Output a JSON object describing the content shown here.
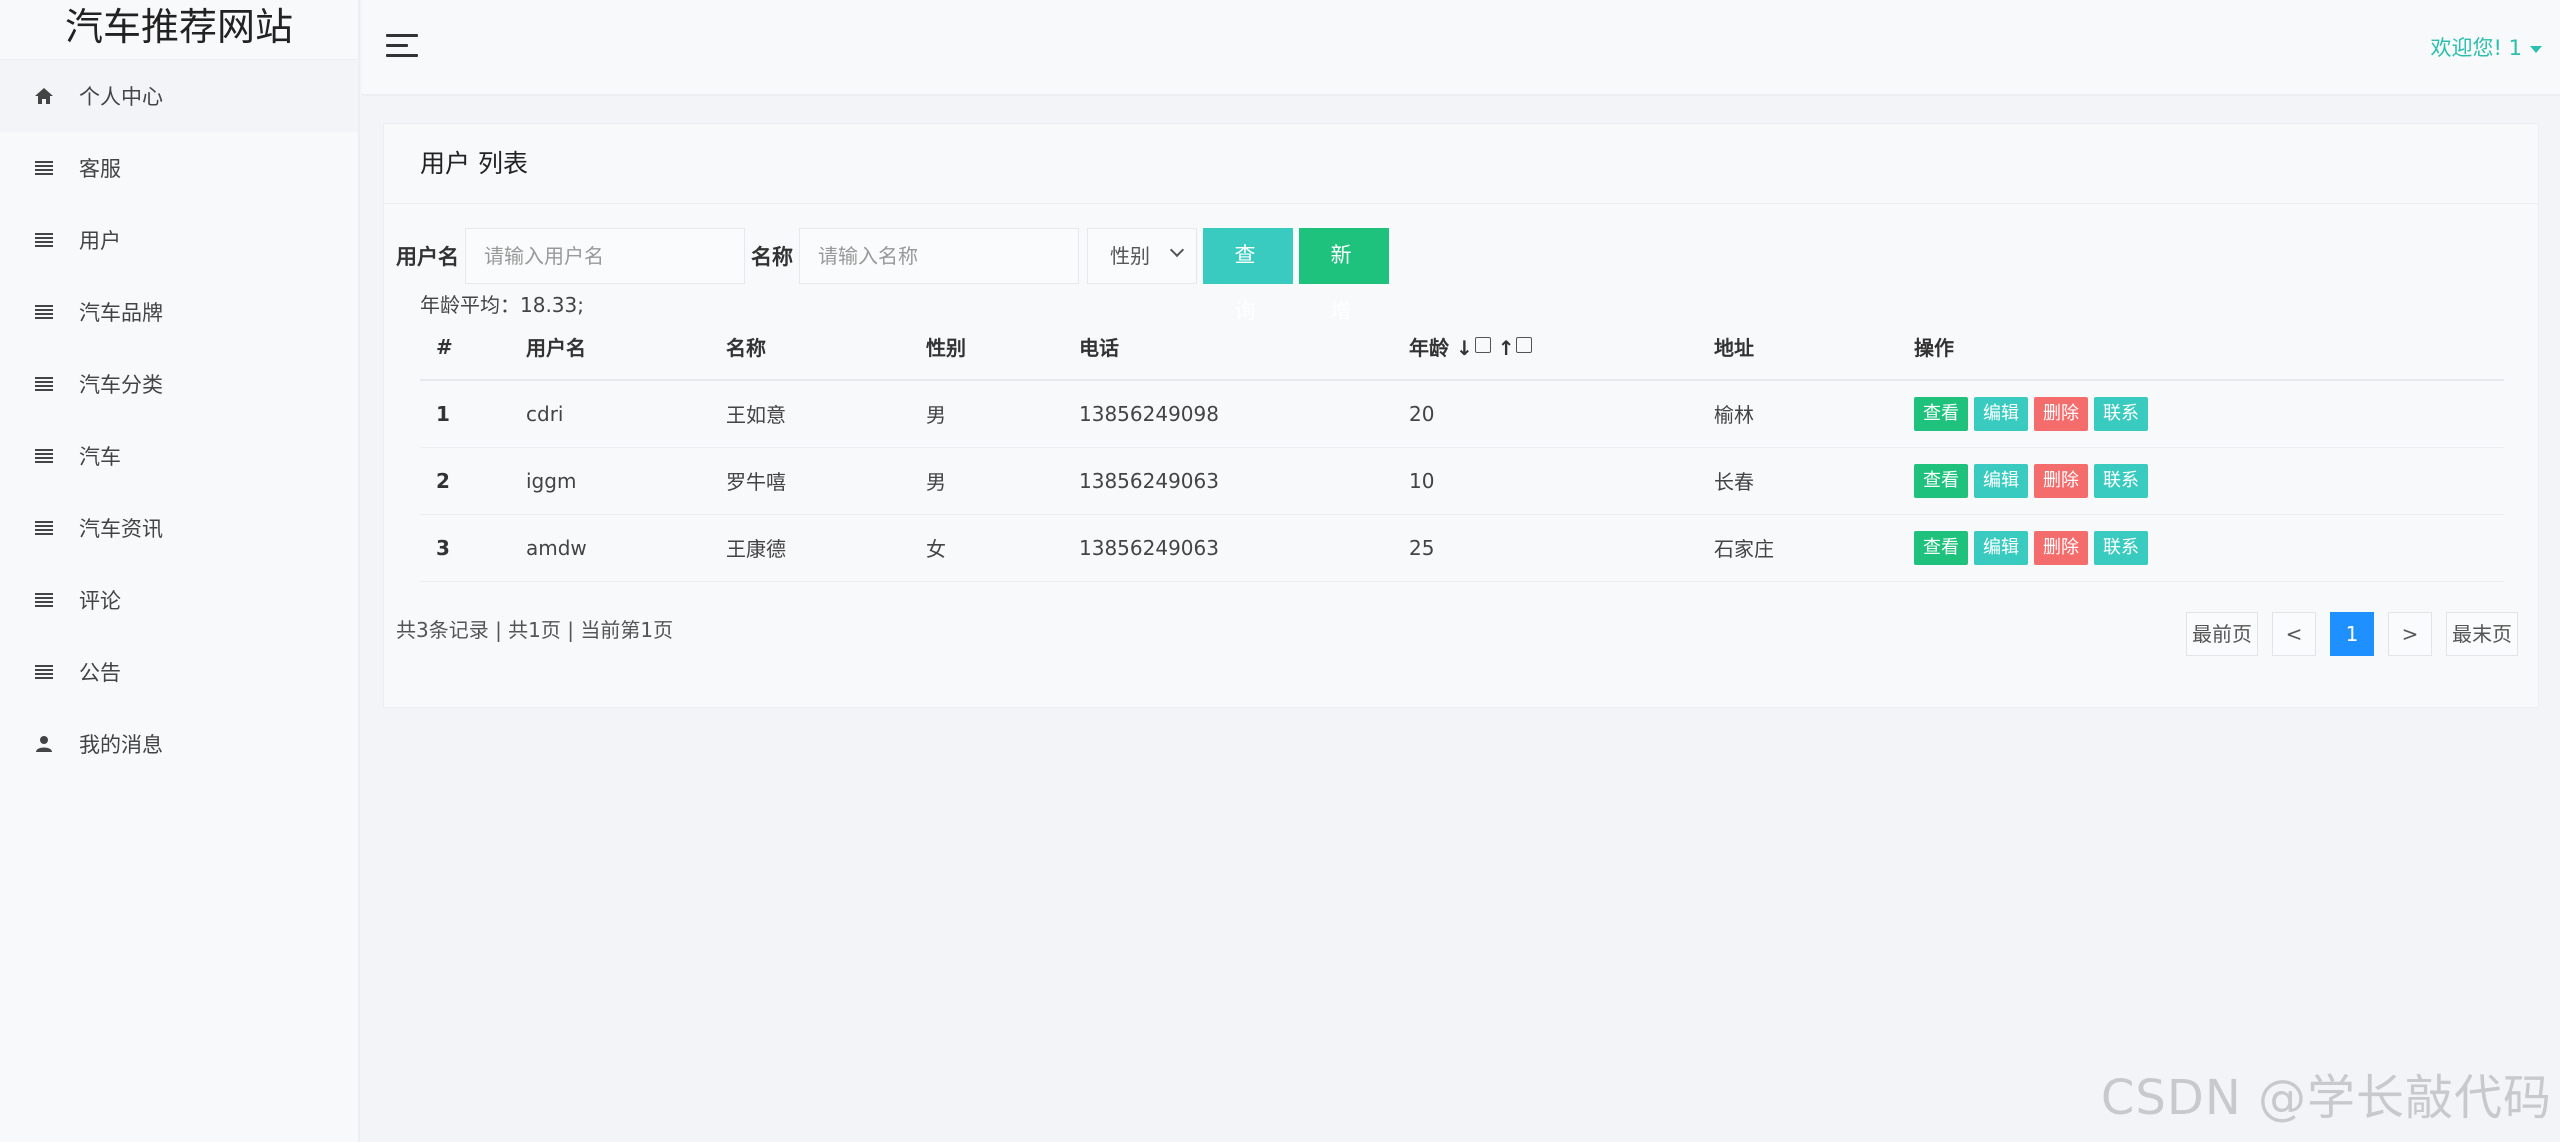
{
  "brand": "汽车推荐网站",
  "sidebar": {
    "items": [
      {
        "label": "个人中心",
        "icon": "home-icon"
      },
      {
        "label": "客服",
        "icon": "list-icon"
      },
      {
        "label": "用户",
        "icon": "list-icon"
      },
      {
        "label": "汽车品牌",
        "icon": "list-icon"
      },
      {
        "label": "汽车分类",
        "icon": "list-icon"
      },
      {
        "label": "汽车",
        "icon": "list-icon"
      },
      {
        "label": "汽车资讯",
        "icon": "list-icon"
      },
      {
        "label": "评论",
        "icon": "list-icon"
      },
      {
        "label": "公告",
        "icon": "list-icon"
      },
      {
        "label": "我的消息",
        "icon": "user-icon"
      }
    ]
  },
  "header": {
    "welcome": "欢迎您! 1",
    "accent_color": "#2dbfae"
  },
  "card": {
    "title": "用户 列表"
  },
  "search": {
    "username_label": "用户名",
    "username_placeholder": "请输入用户名",
    "name_label": "名称",
    "name_placeholder": "请输入名称",
    "gender_selected": "性别",
    "query_button": "查 询",
    "add_button": "新 增"
  },
  "stats": {
    "avg_age": "年龄平均：18.33;"
  },
  "table": {
    "headers": [
      "#",
      "用户名",
      "名称",
      "性别",
      "电话",
      "年龄 ↓",
      "↑",
      "地址",
      "操作"
    ],
    "rows": [
      {
        "no": "1",
        "username": "cdri",
        "name": "王如意",
        "gender": "男",
        "phone": "13856249098",
        "age": "20",
        "address": "榆林"
      },
      {
        "no": "2",
        "username": "iggm",
        "name": "罗牛嘻",
        "gender": "男",
        "phone": "13856249063",
        "age": "10",
        "address": "长春"
      },
      {
        "no": "3",
        "username": "amdw",
        "name": "王康德",
        "gender": "女",
        "phone": "13856249063",
        "age": "25",
        "address": "石家庄"
      }
    ],
    "actions": {
      "view": "查看",
      "edit": "编辑",
      "delete": "删除",
      "contact": "联系"
    }
  },
  "pagination": {
    "summary": "共3条记录 | 共1页 | 当前第1页",
    "first": "最前页",
    "prev": "<",
    "current": "1",
    "next": ">",
    "last": "最末页"
  },
  "watermark": "CSDN @学长敲代码"
}
